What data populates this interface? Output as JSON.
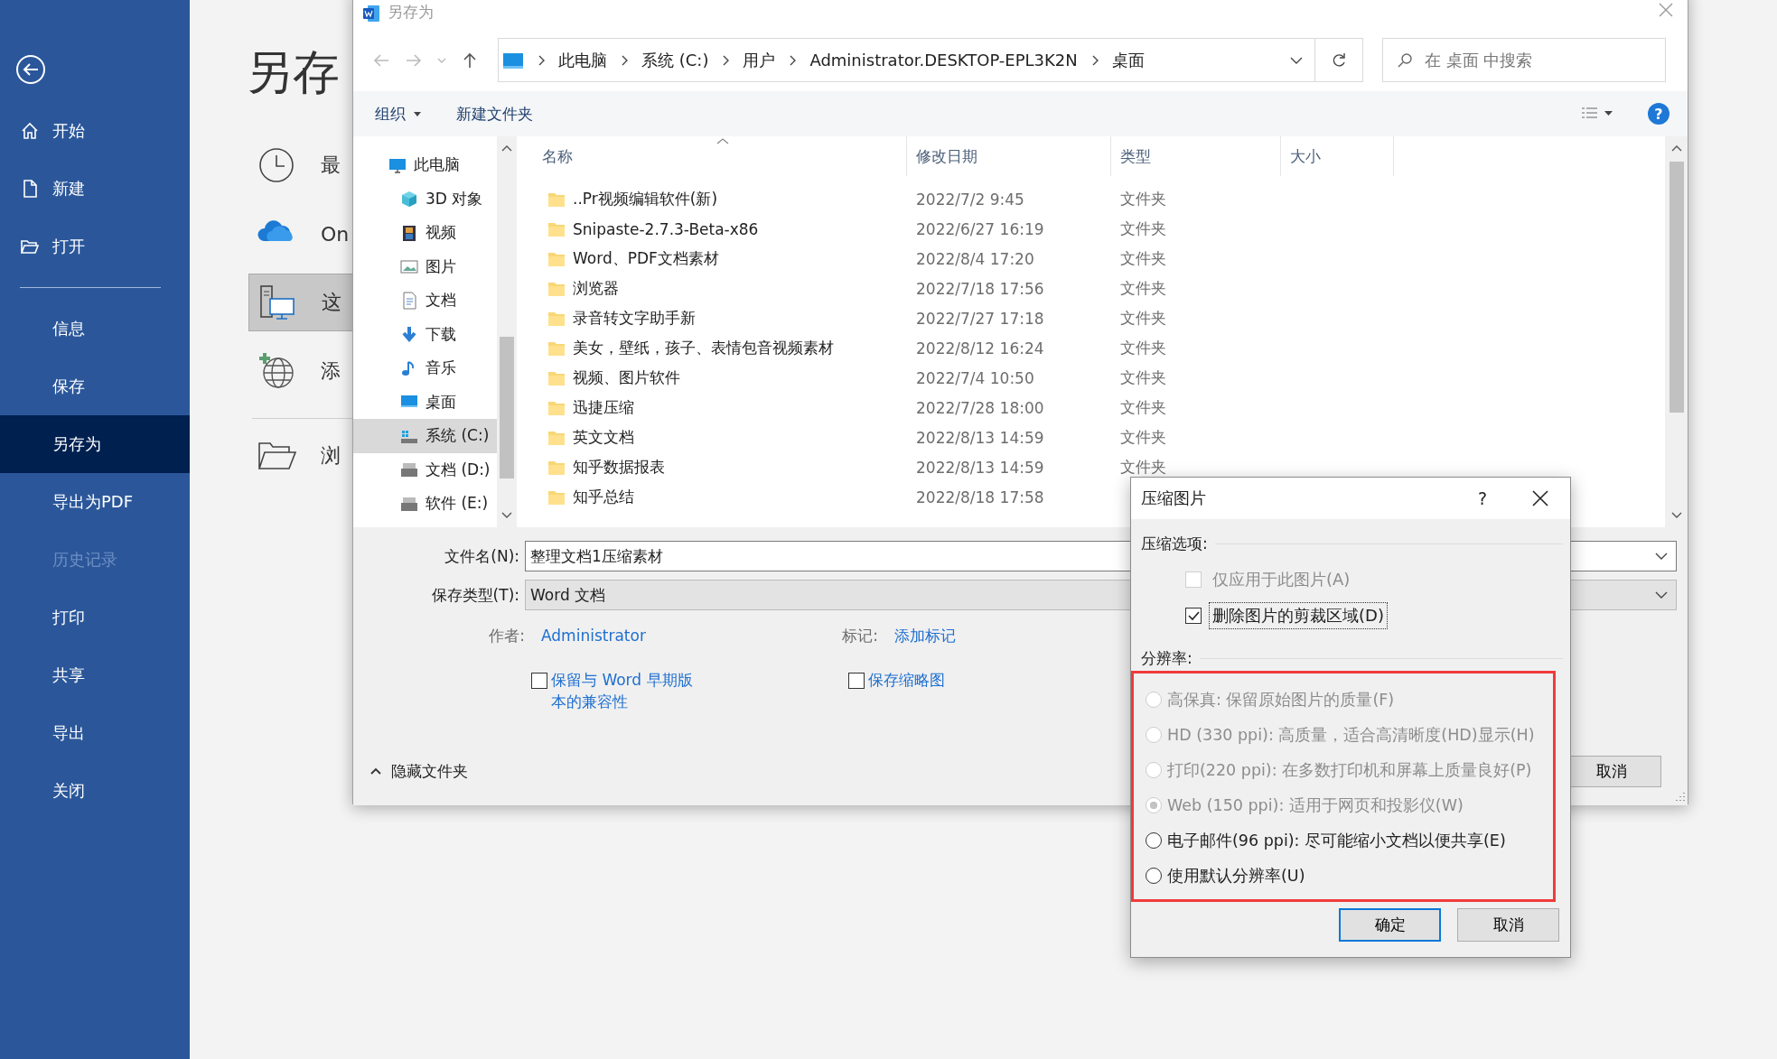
{
  "backstage": {
    "nav": [
      {
        "label": "开始"
      },
      {
        "label": "新建"
      },
      {
        "label": "打开"
      }
    ],
    "items": [
      {
        "label": "信息",
        "selected": false,
        "disabled": false
      },
      {
        "label": "保存",
        "selected": false,
        "disabled": false
      },
      {
        "label": "另存为",
        "selected": true,
        "disabled": false
      },
      {
        "label": "导出为PDF",
        "selected": false,
        "disabled": false
      },
      {
        "label": "历史记录",
        "selected": false,
        "disabled": true
      },
      {
        "label": "打印",
        "selected": false,
        "disabled": false
      },
      {
        "label": "共享",
        "selected": false,
        "disabled": false
      },
      {
        "label": "导出",
        "selected": false,
        "disabled": false
      },
      {
        "label": "关闭",
        "selected": false,
        "disabled": false
      }
    ],
    "title": "另存",
    "locations": [
      {
        "label": "最",
        "selected": false
      },
      {
        "label": "On",
        "selected": false
      },
      {
        "label": "这",
        "selected": true
      },
      {
        "label": "添",
        "selected": false
      },
      {
        "label": "浏",
        "selected": false
      }
    ]
  },
  "save_dialog": {
    "title": "另存为",
    "address": [
      "此电脑",
      "系统 (C:)",
      "用户",
      "Administrator.DESKTOP-EPL3K2N",
      "桌面"
    ],
    "search": {
      "placeholder": "在 桌面 中搜索"
    },
    "toolbar": [
      {
        "label": "组织",
        "menu": true
      },
      {
        "label": "新建文件夹",
        "menu": false
      }
    ],
    "help_label": "?",
    "nav_tree": [
      {
        "label": "此电脑",
        "selected": false,
        "children": [
          {
            "label": "3D 对象",
            "selected": false
          },
          {
            "label": "视频",
            "selected": false
          },
          {
            "label": "图片",
            "selected": false
          },
          {
            "label": "文档",
            "selected": false
          },
          {
            "label": "下载",
            "selected": false
          },
          {
            "label": "音乐",
            "selected": false
          },
          {
            "label": "桌面",
            "selected": false
          },
          {
            "label": "系统 (C:)",
            "selected": true
          },
          {
            "label": "文档 (D:)",
            "selected": false
          },
          {
            "label": "软件 (E:)",
            "selected": false
          }
        ]
      }
    ],
    "columns": [
      "名称",
      "修改日期",
      "类型",
      "大小"
    ],
    "rows": [
      {
        "name": "..Pr视频编辑软件(新)",
        "modified": "2022/7/2 9:45",
        "type": "文件夹"
      },
      {
        "name": "Snipaste-2.7.3-Beta-x86",
        "modified": "2022/6/27 16:19",
        "type": "文件夹"
      },
      {
        "name": "Word、PDF文档素材",
        "modified": "2022/8/4 17:20",
        "type": "文件夹"
      },
      {
        "name": "浏览器",
        "modified": "2022/7/18 17:56",
        "type": "文件夹"
      },
      {
        "name": "录音转文字助手新",
        "modified": "2022/7/27 17:18",
        "type": "文件夹"
      },
      {
        "name": "美女，壁纸，孩子、表情包音视频素材",
        "modified": "2022/8/12 16:24",
        "type": "文件夹"
      },
      {
        "name": "视频、图片软件",
        "modified": "2022/7/4 10:50",
        "type": "文件夹"
      },
      {
        "name": "迅捷压缩",
        "modified": "2022/7/28 18:00",
        "type": "文件夹"
      },
      {
        "name": "英文文档",
        "modified": "2022/8/13 14:59",
        "type": "文件夹"
      },
      {
        "name": "知乎数据报表",
        "modified": "2022/8/13 14:59",
        "type": "文件夹"
      },
      {
        "name": "知乎总结",
        "modified": "2022/8/18 17:58"
      }
    ],
    "file_name": {
      "label": "文件名(N):",
      "value": "整理文档1压缩素材"
    },
    "file_type": {
      "label": "保存类型(T):",
      "value": "Word 文档"
    },
    "author": {
      "label": "作者:",
      "value": "Administrator"
    },
    "tags": {
      "label": "标记:",
      "value": "添加标记"
    },
    "checkboxes": [
      {
        "label": "保留与 Word 早期版本的兼容性",
        "checked": false
      },
      {
        "label": "保存缩略图",
        "checked": false
      }
    ],
    "hide_folders": "隐藏文件夹",
    "cancel": "取消"
  },
  "compress_dialog": {
    "title": "压缩图片",
    "help_label": "?",
    "options": {
      "heading": "压缩选项:",
      "items": [
        {
          "label": "仅应用于此图片(A)",
          "checked": false,
          "disabled": true,
          "focused": false
        },
        {
          "label": "删除图片的剪裁区域(D)",
          "checked": true,
          "disabled": false,
          "focused": true
        }
      ]
    },
    "resolution": {
      "heading": "分辨率:",
      "highlighted": true,
      "items": [
        {
          "label": "高保真: 保留原始图片的质量(F)",
          "selected": false,
          "disabled": true
        },
        {
          "label": "HD (330 ppi): 高质量，适合高清晰度(HD)显示(H)",
          "selected": false,
          "disabled": true
        },
        {
          "label": "打印(220 ppi): 在多数打印机和屏幕上质量良好(P)",
          "selected": false,
          "disabled": true
        },
        {
          "label": "Web (150 ppi): 适用于网页和投影仪(W)",
          "selected": true,
          "disabled": true
        },
        {
          "label": "电子邮件(96 ppi): 尽可能缩小文档以便共享(E)",
          "selected": false,
          "disabled": false
        },
        {
          "label": "使用默认分辨率(U)",
          "selected": false,
          "disabled": false
        }
      ]
    },
    "buttons": [
      {
        "label": "确定",
        "default": true
      },
      {
        "label": "取消",
        "default": false
      }
    ]
  }
}
